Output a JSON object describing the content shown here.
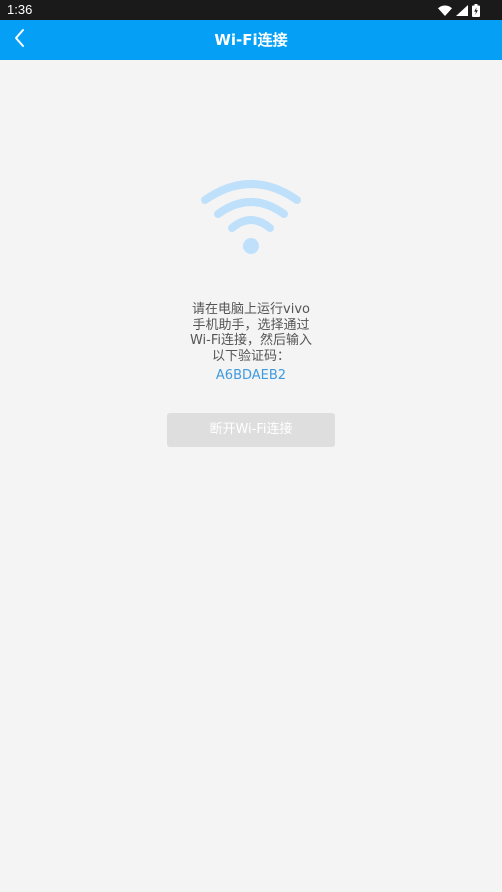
{
  "status_bar": {
    "time": "1:36",
    "icons": [
      "wifi-icon",
      "signal-icon",
      "battery-icon"
    ]
  },
  "app_bar": {
    "title": "Wi-Fi连接",
    "back_icon": "chevron-left-icon"
  },
  "main": {
    "wifi_icon": "wifi-icon",
    "instruction_lines": [
      "请在电脑上运行vivo",
      "手机助手，选择通过",
      "Wi-Fi连接，然后输入",
      "以下验证码："
    ],
    "verification_code": "A6BDAEB2",
    "disconnect_button_label": "断开Wi-Fi连接"
  },
  "colors": {
    "app_bar": "#05a0f5",
    "background": "#f4f4f4",
    "code_text": "#3f9ae0",
    "wifi_icon": "#bfe0fb",
    "button_bg": "#dedede"
  }
}
